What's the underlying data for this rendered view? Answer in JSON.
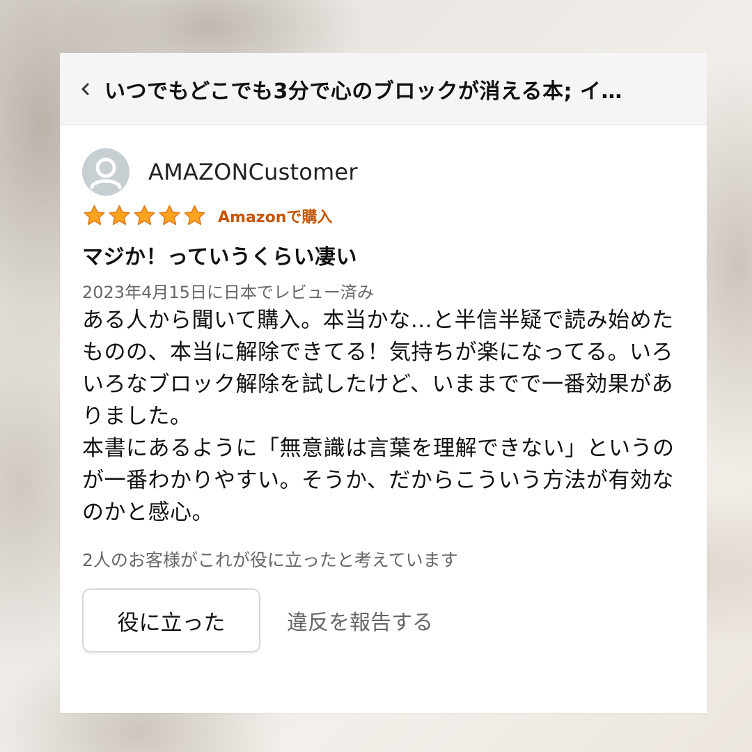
{
  "header": {
    "back_icon": "chevron-left-icon",
    "title": "いつでもどこでも3分で心のブロックが消える本; イ…"
  },
  "review": {
    "avatar_icon": "user-silhouette-icon",
    "reviewer_name": "AMAZONCustomer",
    "rating": 5,
    "rating_max": 5,
    "star_color": "#ffa41c",
    "verified_label": "Amazonで購入",
    "verified_color": "#c45500",
    "title": "マジか！っていうくらい凄い",
    "date": "2023年4月15日に日本でレビュー済み",
    "body": [
      "ある人から聞いて購入。本当かな…と半信半疑で読み始めたものの、本当に解除できてる！気持ちが楽になってる。いろいろなブロック解除を試したけど、いままでで一番効果がありました。",
      "本書にあるように「無意識は言葉を理解できない」というのが一番わかりやすい。そうか、だからこういう方法が有効なのかと感心。"
    ],
    "helpful_count_text": "2人のお客様がこれが役に立ったと考えています",
    "helpful_button_label": "役に立った",
    "report_link_label": "違反を報告する"
  }
}
